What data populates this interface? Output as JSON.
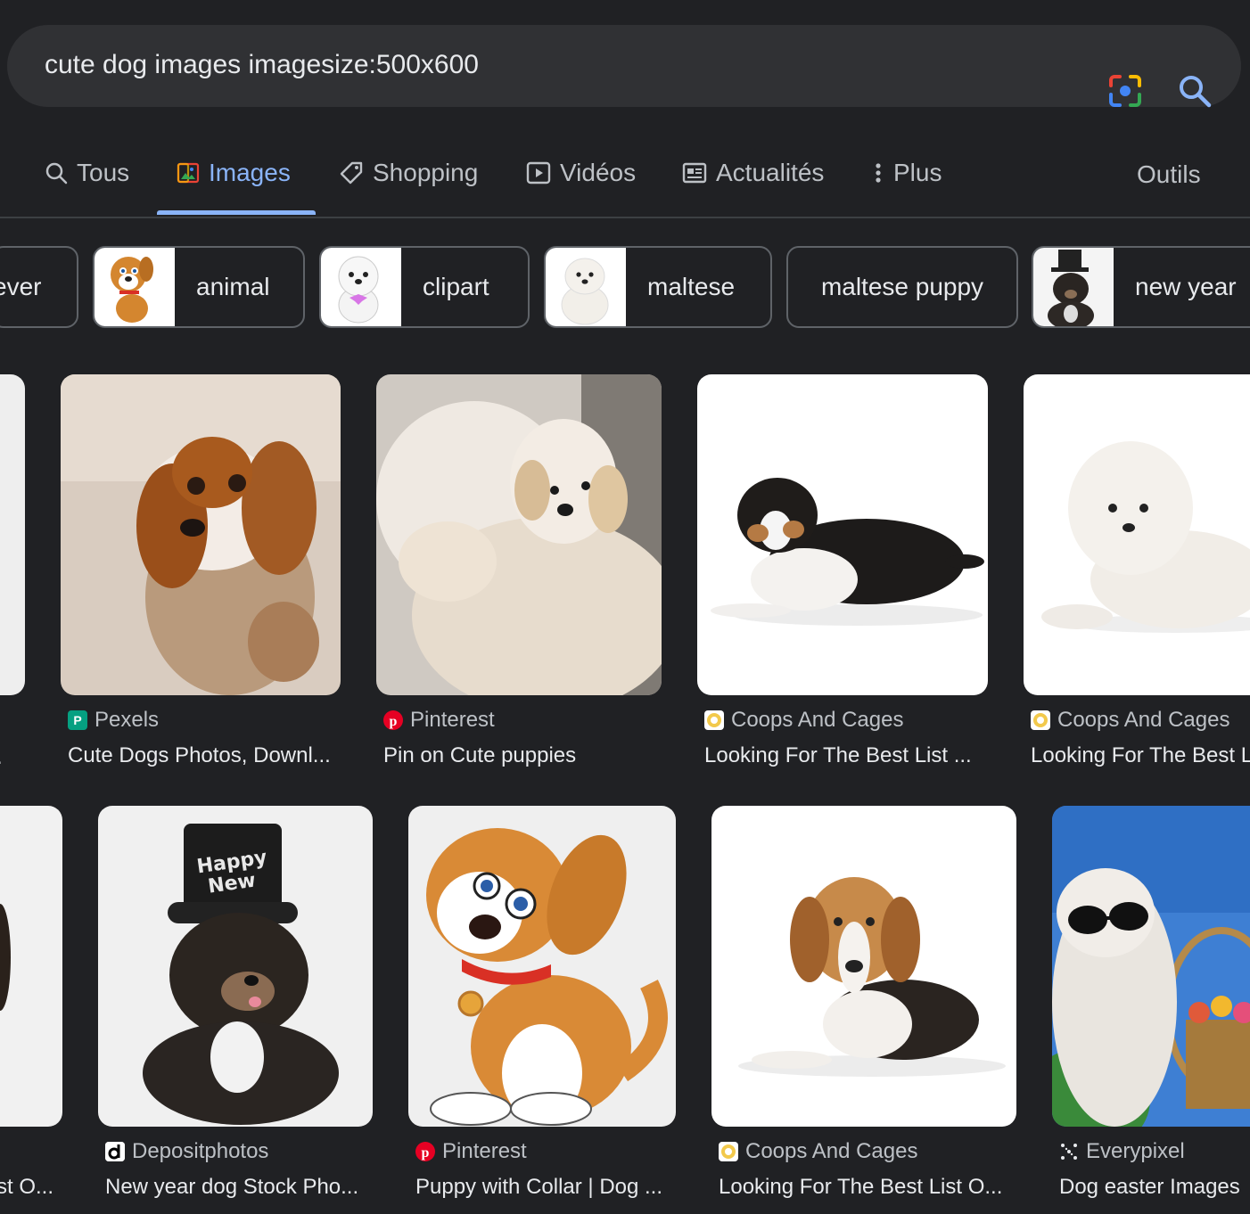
{
  "search": {
    "query": "cute dog images imagesize:500x600",
    "lens_icon": "google-lens-icon",
    "search_icon": "magnifier-icon"
  },
  "tabs": [
    {
      "label": "Tous",
      "icon": "search-icon"
    },
    {
      "label": "Images",
      "icon": "image-icon",
      "active": true
    },
    {
      "label": "Shopping",
      "icon": "tag-icon"
    },
    {
      "label": "Vidéos",
      "icon": "play-icon"
    },
    {
      "label": "Actualités",
      "icon": "newspaper-icon"
    },
    {
      "label": "Plus",
      "icon": "more-vert-icon"
    }
  ],
  "tools_label": "Outils",
  "chips": [
    "ever",
    "animal",
    "clipart",
    "maltese",
    "maltese puppy",
    "new year"
  ],
  "results": [
    {
      "source": "Pexels",
      "title": "Cute Dogs Photos, Downl..."
    },
    {
      "source": "Pinterest",
      "title": "Pin on Cute puppies"
    },
    {
      "source": "Coops And Cages",
      "title": "Looking For The Best List ..."
    },
    {
      "source": "Coops And Cages",
      "title": "Looking For The Best L"
    },
    {
      "source": "Depositphotos",
      "title": "New year dog Stock Pho..."
    },
    {
      "source": "Pinterest",
      "title": "Puppy with Collar | Dog ..."
    },
    {
      "source": "Coops And Cages",
      "title": "Looking For The Best List O..."
    },
    {
      "source": "Everypixel",
      "title": "Dog easter Images"
    }
  ],
  "partial_titles": {
    "row1": ".",
    "row2": "st O..."
  },
  "colors": {
    "background": "#202124",
    "search_bg": "#303134",
    "accent": "#8ab4f8",
    "text": "#e8eaed",
    "muted": "#bdc1c6",
    "pinterest": "#e60023",
    "pexels": "#05a081"
  }
}
